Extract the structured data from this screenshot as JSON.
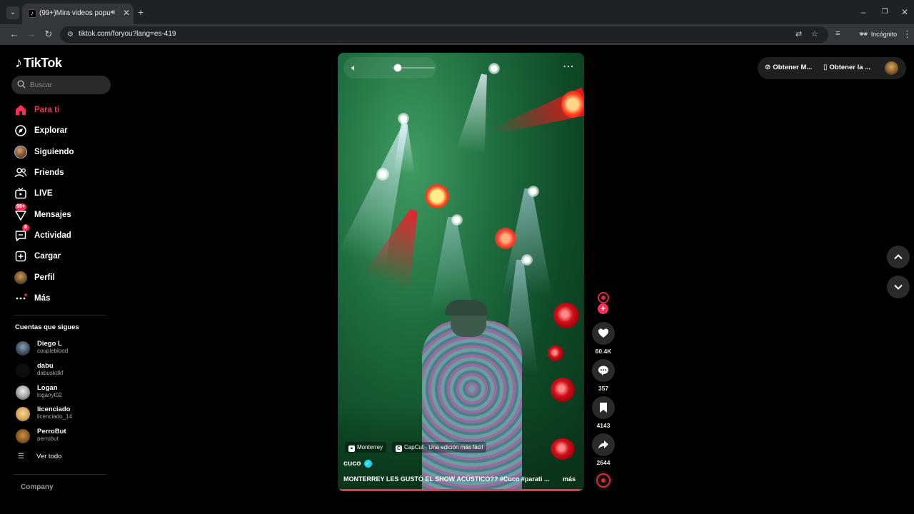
{
  "browser": {
    "tab_title": "(99+)Mira videos populares",
    "url": "tiktok.com/foryou?lang=es-419",
    "incognito_label": "Incógnito"
  },
  "app": {
    "logo_text": "TikTok",
    "search_placeholder": "Buscar",
    "nav": [
      {
        "label": "Para ti",
        "icon": "home-icon",
        "active": true
      },
      {
        "label": "Explorar",
        "icon": "compass-icon"
      },
      {
        "label": "Siguiendo",
        "icon": "following-avatar"
      },
      {
        "label": "Friends",
        "icon": "friends-icon"
      },
      {
        "label": "LIVE",
        "icon": "live-tv-icon"
      },
      {
        "label": "Mensajes",
        "icon": "messages-icon",
        "badge": "99+"
      },
      {
        "label": "Actividad",
        "icon": "activity-icon",
        "badge": "8"
      },
      {
        "label": "Cargar",
        "icon": "upload-icon"
      },
      {
        "label": "Perfil",
        "icon": "profile-avatar"
      },
      {
        "label": "Más",
        "icon": "more-dots-icon"
      }
    ],
    "following_title": "Cuentas que sigues",
    "following": [
      {
        "name": "Diego L",
        "username": "coupleblood"
      },
      {
        "name": "dabu",
        "username": "dabuskdkf"
      },
      {
        "name": "Logan",
        "username": "loganyt02"
      },
      {
        "name": "licenciado",
        "username": "licenciado_14"
      },
      {
        "name": "PerroBut",
        "username": "perrobut"
      }
    ],
    "see_all": "Ver todo",
    "company": "Company",
    "top_right": {
      "get_app_1": "Obtener M...",
      "get_app_2": "Obtener la ..."
    }
  },
  "video": {
    "location_chip": "Monterrey",
    "capcut_chip": "CapCut · Una edición más fácil",
    "author": "cuco",
    "caption": "MONTERREY LES GUSTÓ EL SHOW ACÚSTICO?? #Cuco #parati ...",
    "more": "más",
    "progress": 0.98,
    "likes": "60.4K",
    "comments": "357",
    "saves": "4143",
    "shares": "2644"
  },
  "colors": {
    "accent": "#fe2c55",
    "background": "#000000",
    "verified": "#20d5ec"
  }
}
